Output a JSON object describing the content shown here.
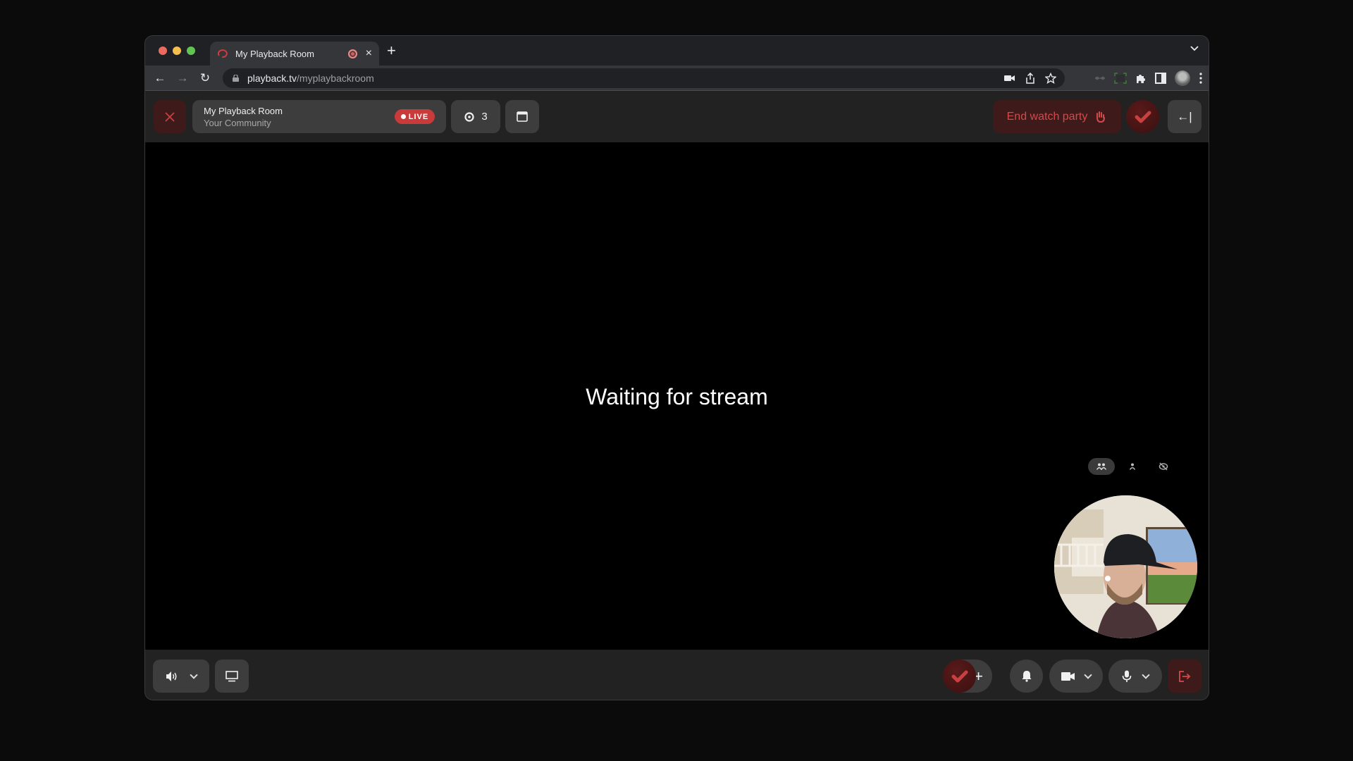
{
  "browser": {
    "tab": {
      "title": "My Playback Room",
      "favicon": "playback-logo-icon",
      "recording_indicator": "recording-icon",
      "close_label": "×"
    },
    "new_tab_label": "+",
    "tab_menu_icon": "chevron-down-icon",
    "nav": {
      "back": "←",
      "forward": "→",
      "reload": "↻"
    },
    "url": {
      "host": "playback.tv",
      "path": "/myplaybackroom"
    },
    "omnibox_icons": [
      "camera-in-use-icon",
      "share-icon",
      "bookmark-star-icon"
    ],
    "toolbar_icons": [
      "extension-dots-icon",
      "screen-capture-icon",
      "extensions-puzzle-icon",
      "side-panel-icon",
      "profile-avatar",
      "more-menu-icon"
    ]
  },
  "header": {
    "close_icon": "close-icon",
    "room_name": "My Playback Room",
    "community": "Your Community",
    "live_label": "LIVE",
    "viewer_count": "3",
    "end_party_label": "End watch party",
    "end_party_icon": "waving-hand-icon",
    "collapse_label": "←|"
  },
  "stage": {
    "status_text": "Waiting for stream",
    "view_modes": [
      "group-view-icon",
      "single-view-icon",
      "hide-view-icon"
    ],
    "active_view_mode": "group-view-icon"
  },
  "controls": {
    "plus_label": "+",
    "buttons": [
      "volume-icon",
      "screen-share-icon",
      "reaction-icon",
      "add-icon",
      "notification-bell-icon",
      "camera-icon",
      "microphone-icon",
      "leave-icon"
    ]
  },
  "colors": {
    "accent_red": "#c93a3a",
    "danger_bg": "#3f1a1a",
    "danger_text": "#d24a4a"
  }
}
